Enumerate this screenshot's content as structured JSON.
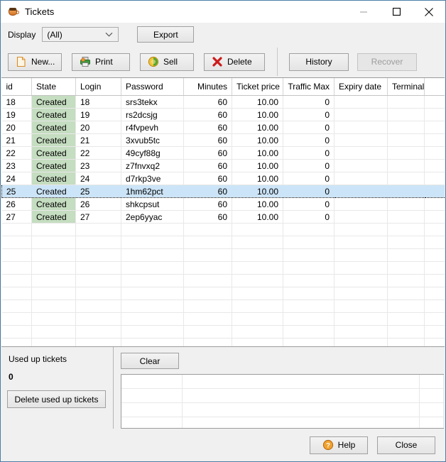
{
  "window": {
    "title": "Tickets",
    "icon": "coffee-cup-icon",
    "controls": {
      "minimize": "minimize-icon",
      "maximize": "maximize-icon",
      "close": "close-icon"
    }
  },
  "display_bar": {
    "label": "Display",
    "filter_value": "(All)",
    "filter_options": [
      "(All)"
    ],
    "export_label": "Export"
  },
  "toolbar": {
    "buttons": [
      {
        "label": "New...",
        "icon": "new-document-icon",
        "enabled": true
      },
      {
        "label": "Print",
        "icon": "printer-icon",
        "enabled": true
      },
      {
        "label": "Sell",
        "icon": "coin-icon",
        "enabled": true
      },
      {
        "label": "Delete",
        "icon": "red-cross-icon",
        "enabled": true
      }
    ],
    "right_buttons": [
      {
        "label": "History",
        "enabled": true
      },
      {
        "label": "Recover",
        "enabled": false
      }
    ]
  },
  "table": {
    "columns": [
      "id",
      "State",
      "Login",
      "Password",
      "Minutes",
      "Ticket price",
      "Traffic Max",
      "Expiry date",
      "Terminal",
      ""
    ],
    "selected_row_index": 7,
    "rows": [
      {
        "id": "18",
        "state": "Created",
        "login": "18",
        "password": "srs3tekx",
        "minutes": "60",
        "ticket_price": "10.00",
        "traffic_max": "0",
        "expiry_date": "",
        "terminal": ""
      },
      {
        "id": "19",
        "state": "Created",
        "login": "19",
        "password": "rs2dcsjg",
        "minutes": "60",
        "ticket_price": "10.00",
        "traffic_max": "0",
        "expiry_date": "",
        "terminal": ""
      },
      {
        "id": "20",
        "state": "Created",
        "login": "20",
        "password": "r4fvpevh",
        "minutes": "60",
        "ticket_price": "10.00",
        "traffic_max": "0",
        "expiry_date": "",
        "terminal": ""
      },
      {
        "id": "21",
        "state": "Created",
        "login": "21",
        "password": "3xvub5tc",
        "minutes": "60",
        "ticket_price": "10.00",
        "traffic_max": "0",
        "expiry_date": "",
        "terminal": ""
      },
      {
        "id": "22",
        "state": "Created",
        "login": "22",
        "password": "49cyf88g",
        "minutes": "60",
        "ticket_price": "10.00",
        "traffic_max": "0",
        "expiry_date": "",
        "terminal": ""
      },
      {
        "id": "23",
        "state": "Created",
        "login": "23",
        "password": "z7fnvxq2",
        "minutes": "60",
        "ticket_price": "10.00",
        "traffic_max": "0",
        "expiry_date": "",
        "terminal": ""
      },
      {
        "id": "24",
        "state": "Created",
        "login": "24",
        "password": "d7rkp3ve",
        "minutes": "60",
        "ticket_price": "10.00",
        "traffic_max": "0",
        "expiry_date": "",
        "terminal": ""
      },
      {
        "id": "25",
        "state": "Created",
        "login": "25",
        "password": "1hm62pct",
        "minutes": "60",
        "ticket_price": "10.00",
        "traffic_max": "0",
        "expiry_date": "",
        "terminal": ""
      },
      {
        "id": "26",
        "state": "Created",
        "login": "26",
        "password": "shkcpsut",
        "minutes": "60",
        "ticket_price": "10.00",
        "traffic_max": "0",
        "expiry_date": "",
        "terminal": ""
      },
      {
        "id": "27",
        "state": "Created",
        "login": "27",
        "password": "2ep6yyac",
        "minutes": "60",
        "ticket_price": "10.00",
        "traffic_max": "0",
        "expiry_date": "",
        "terminal": ""
      }
    ],
    "empty_row_count": 11
  },
  "bottom_left": {
    "used_up_label": "Used up tickets",
    "used_up_count": "0",
    "delete_used_label": "Delete used up tickets"
  },
  "bottom_right": {
    "clear_label": "Clear",
    "log_rows": 5,
    "log_entries": []
  },
  "footer": {
    "help_label": "Help",
    "help_icon": "question-mark-icon",
    "close_label": "Close"
  },
  "colors": {
    "window_border": "#4c7da5",
    "chrome": "#f0f0f0",
    "state_created": "#c5ddc0",
    "selection": "#cce4f7",
    "grid_line": "#e8e8e8",
    "disabled_text": "#9d9d9d"
  }
}
